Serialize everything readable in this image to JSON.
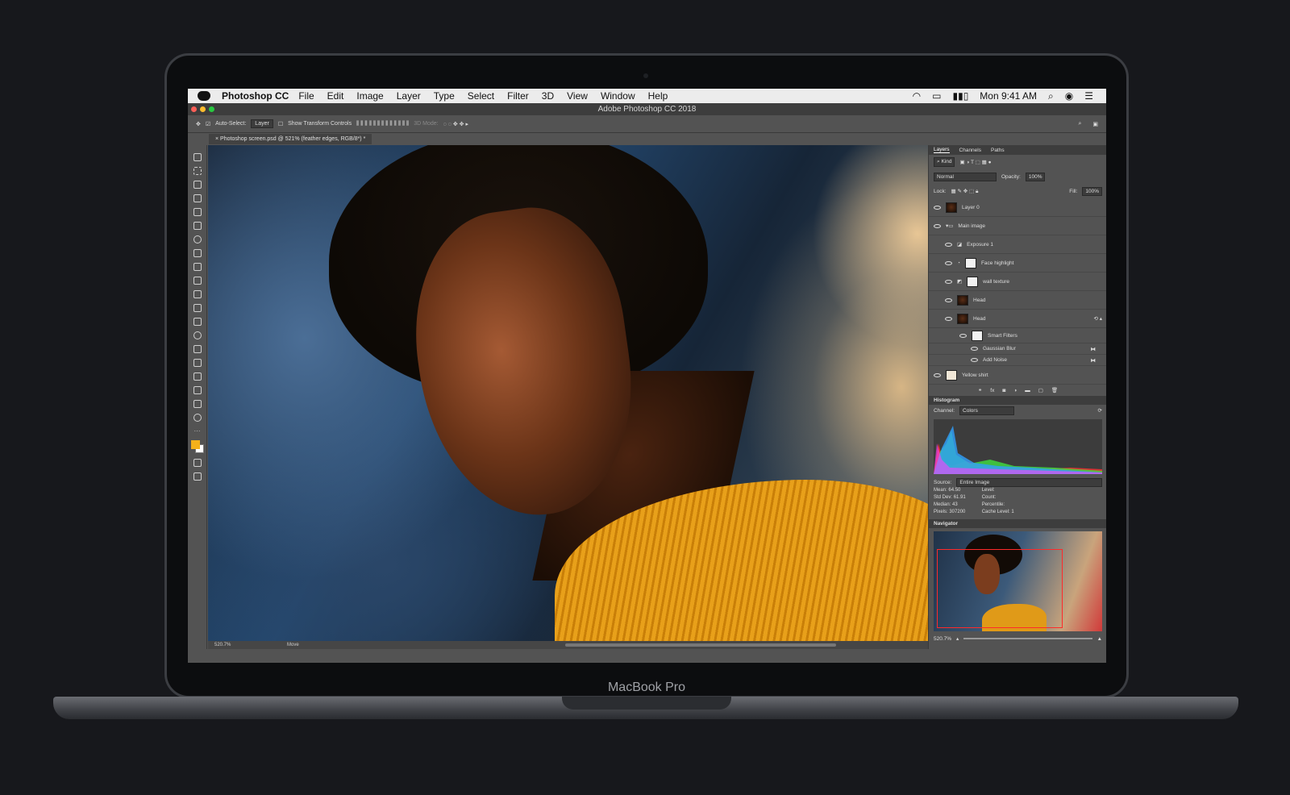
{
  "device": {
    "brand": "MacBook Pro"
  },
  "menubar": {
    "app_name": "Photoshop CC",
    "menus": [
      "File",
      "Edit",
      "Image",
      "Layer",
      "Type",
      "Select",
      "Filter",
      "3D",
      "View",
      "Window",
      "Help"
    ],
    "clock": "Mon 9:41 AM"
  },
  "window": {
    "title": "Adobe Photoshop CC 2018"
  },
  "options_bar": {
    "auto_select_label": "Auto-Select:",
    "auto_select_value": "Layer",
    "transform_label": "Show Transform Controls",
    "mode_3d": "3D Mode:"
  },
  "document_tab": {
    "label": "Photoshop screen.psd @ 521% (feather edges, RGB/8*) *"
  },
  "status": {
    "zoom": "520.7%",
    "tool": "Move"
  },
  "layers_panel": {
    "tabs": [
      "Layers",
      "Channels",
      "Paths"
    ],
    "kind_filter": "Kind",
    "blend_mode": "Normal",
    "opacity_label": "Opacity:",
    "opacity_value": "100%",
    "lock_label": "Lock:",
    "fill_label": "Fill:",
    "fill_value": "100%",
    "layers": [
      {
        "name": "Layer 0"
      },
      {
        "name": "Main image"
      },
      {
        "name": "Exposure 1"
      },
      {
        "name": "Face highlight"
      },
      {
        "name": "wall texture"
      },
      {
        "name": "Head"
      },
      {
        "name": "Head"
      },
      {
        "name": "Smart Filters"
      },
      {
        "name": "Gaussian Blur"
      },
      {
        "name": "Add Noise"
      },
      {
        "name": "Yellow shirt"
      }
    ]
  },
  "histogram": {
    "title": "Histogram",
    "channel_label": "Channel:",
    "channel_value": "Colors",
    "source_label": "Source:",
    "source_value": "Entire Image",
    "stats_left": [
      {
        "label": "Mean:",
        "value": "64.50"
      },
      {
        "label": "Std Dev:",
        "value": "61.91"
      },
      {
        "label": "Median:",
        "value": "43"
      },
      {
        "label": "Pixels:",
        "value": "307200"
      }
    ],
    "stats_right": [
      {
        "label": "Level:"
      },
      {
        "label": "Count:"
      },
      {
        "label": "Percentile:"
      },
      {
        "label": "Cache Level:",
        "value": "1"
      }
    ]
  },
  "navigator": {
    "title": "Navigator",
    "zoom": "520.7%"
  },
  "colors": {
    "foreground": "#f4b11b",
    "background": "#ffffff"
  }
}
